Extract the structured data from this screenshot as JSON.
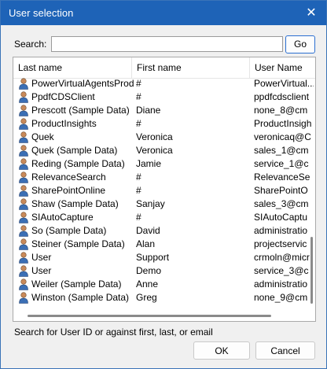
{
  "window": {
    "title": "User selection",
    "close_glyph": "✕"
  },
  "search": {
    "label": "Search:",
    "value": "",
    "placeholder": "",
    "go_label": "Go"
  },
  "list": {
    "columns": [
      "Last name",
      "First name",
      "User Name"
    ],
    "rows": [
      {
        "last": "PowerVirtualAgentsProd",
        "first": "#",
        "user": "PowerVirtual..."
      },
      {
        "last": "PpdfCDSClient",
        "first": "#",
        "user": "ppdfcdsclient"
      },
      {
        "last": "Prescott (Sample Data)",
        "first": "Diane",
        "user": "none_8@cm"
      },
      {
        "last": "ProductInsights",
        "first": "#",
        "user": "ProductInsigh"
      },
      {
        "last": "Quek",
        "first": "Veronica",
        "user": "veronicaq@C"
      },
      {
        "last": "Quek (Sample Data)",
        "first": "Veronica",
        "user": "sales_1@cm"
      },
      {
        "last": "Reding (Sample Data)",
        "first": "Jamie",
        "user": "service_1@c"
      },
      {
        "last": "RelevanceSearch",
        "first": "#",
        "user": "RelevanceSe"
      },
      {
        "last": "SharePointOnline",
        "first": "#",
        "user": "SharePointO"
      },
      {
        "last": "Shaw (Sample Data)",
        "first": "Sanjay",
        "user": "sales_3@cm"
      },
      {
        "last": "SIAutoCapture",
        "first": "#",
        "user": "SIAutoCaptu"
      },
      {
        "last": "So (Sample Data)",
        "first": "David",
        "user": "administratio"
      },
      {
        "last": "Steiner (Sample Data)",
        "first": "Alan",
        "user": "projectservic"
      },
      {
        "last": "User",
        "first": "Support",
        "user": "crmoln@micr"
      },
      {
        "last": "User",
        "first": "Demo",
        "user": "service_3@c"
      },
      {
        "last": "Weiler (Sample Data)",
        "first": "Anne",
        "user": "administratio"
      },
      {
        "last": "Winston (Sample Data)",
        "first": "Greg",
        "user": "none_9@cm"
      }
    ],
    "row_icon": "user-icon"
  },
  "status": {
    "text": "Search for User ID or against first, last, or email"
  },
  "buttons": {
    "ok": "OK",
    "cancel": "Cancel"
  },
  "colors": {
    "titlebar": "#1e63b7",
    "accent": "#2b6fd1"
  }
}
